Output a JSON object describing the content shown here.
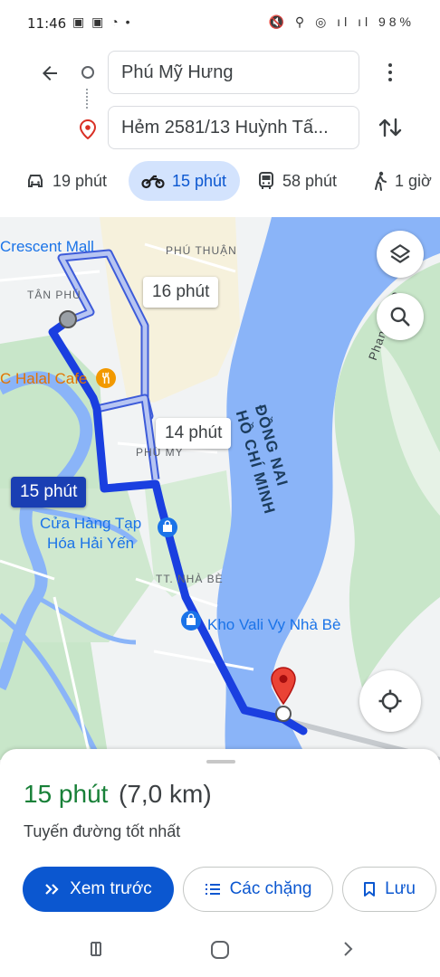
{
  "status_bar": {
    "time": "11:46",
    "left_icons": "▣ ▣ ◔ •",
    "right_icons": "🔇 ⚲ ◎ ıl ıl",
    "battery": "98%"
  },
  "route": {
    "origin": "Phú Mỹ Hưng",
    "destination": "Hẻm 2581/13 Huỳnh Tấ..."
  },
  "modes": [
    {
      "icon": "car-icon",
      "label": "19 phút",
      "active": false
    },
    {
      "icon": "motorbike-icon",
      "label": "15 phút",
      "active": true
    },
    {
      "icon": "transit-icon",
      "label": "58 phút",
      "active": false
    },
    {
      "icon": "walk-icon",
      "label": "1 giờ",
      "active": false
    }
  ],
  "map": {
    "area_labels": {
      "crescent": "Crescent Mall",
      "phu_thuan": "PHÚ THUẬN",
      "tan_phu": "TÂN PHÚ",
      "phu_my": "PHÚ MỸ",
      "tt_nha_be": "TT. NHÀ BÈ",
      "phan_van": "Phan Văn Đ"
    },
    "pois": {
      "halal_cafe": "C Halal Cafe",
      "grocery": "Cửa Hàng Tạp\nHóa Hải Yến",
      "vali": "Kho Vali Vy Nhà Bè"
    },
    "river": "ĐỒNG NAI\nHỒ CHÍ MINH",
    "route_chips": {
      "alt1": "16 phút",
      "alt2": "14 phút",
      "selected": "15 phút"
    }
  },
  "sheet": {
    "time": "15 phút",
    "distance": "(7,0 km)",
    "subtitle": "Tuyến đường tốt nhất",
    "preview_btn": "Xem trước",
    "steps_btn": "Các chặng",
    "save_btn": "Lưu"
  },
  "colors": {
    "accent": "#0b57d0",
    "route_selected": "#1a3fe0",
    "route_alt": "#a7b8ef",
    "time_green": "#188038",
    "water": "#8ab4f8",
    "park": "#bde3c4"
  }
}
